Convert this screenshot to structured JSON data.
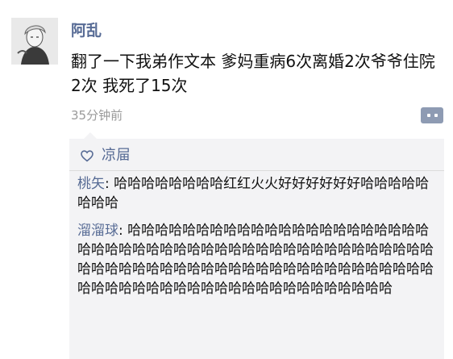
{
  "post": {
    "author": "阿乱",
    "text": "翻了一下我弟作文本 爹妈重病6次离婚2次爷爷住院2次 我死了15次",
    "time": "35分钟前"
  },
  "likes": {
    "icon": "heart-outline-icon",
    "names": "凉屇"
  },
  "comments": [
    {
      "author": "桃矢",
      "separator": ": ",
      "text": "哈哈哈哈哈哈哈哈红红火火好好好好好好哈哈哈哈哈哈哈哈"
    },
    {
      "author": "溜溜球",
      "separator": ": ",
      "text": "哈哈哈哈哈哈哈哈哈哈哈哈哈哈哈哈哈哈哈哈哈哈哈哈哈哈哈哈哈哈哈哈哈哈哈哈哈哈哈哈哈哈哈哈哈哈哈哈哈哈哈哈哈哈哈哈哈哈哈哈哈哈哈哈哈哈哈哈哈哈哈哈哈哈哈哈哈哈哈哈哈哈哈哈哈哈哈哈哈哈哈哈哈哈哈哈哈"
    }
  ],
  "colors": {
    "link": "#576b95",
    "panel_bg": "#f3f3f5",
    "time": "#9a9a9a"
  }
}
